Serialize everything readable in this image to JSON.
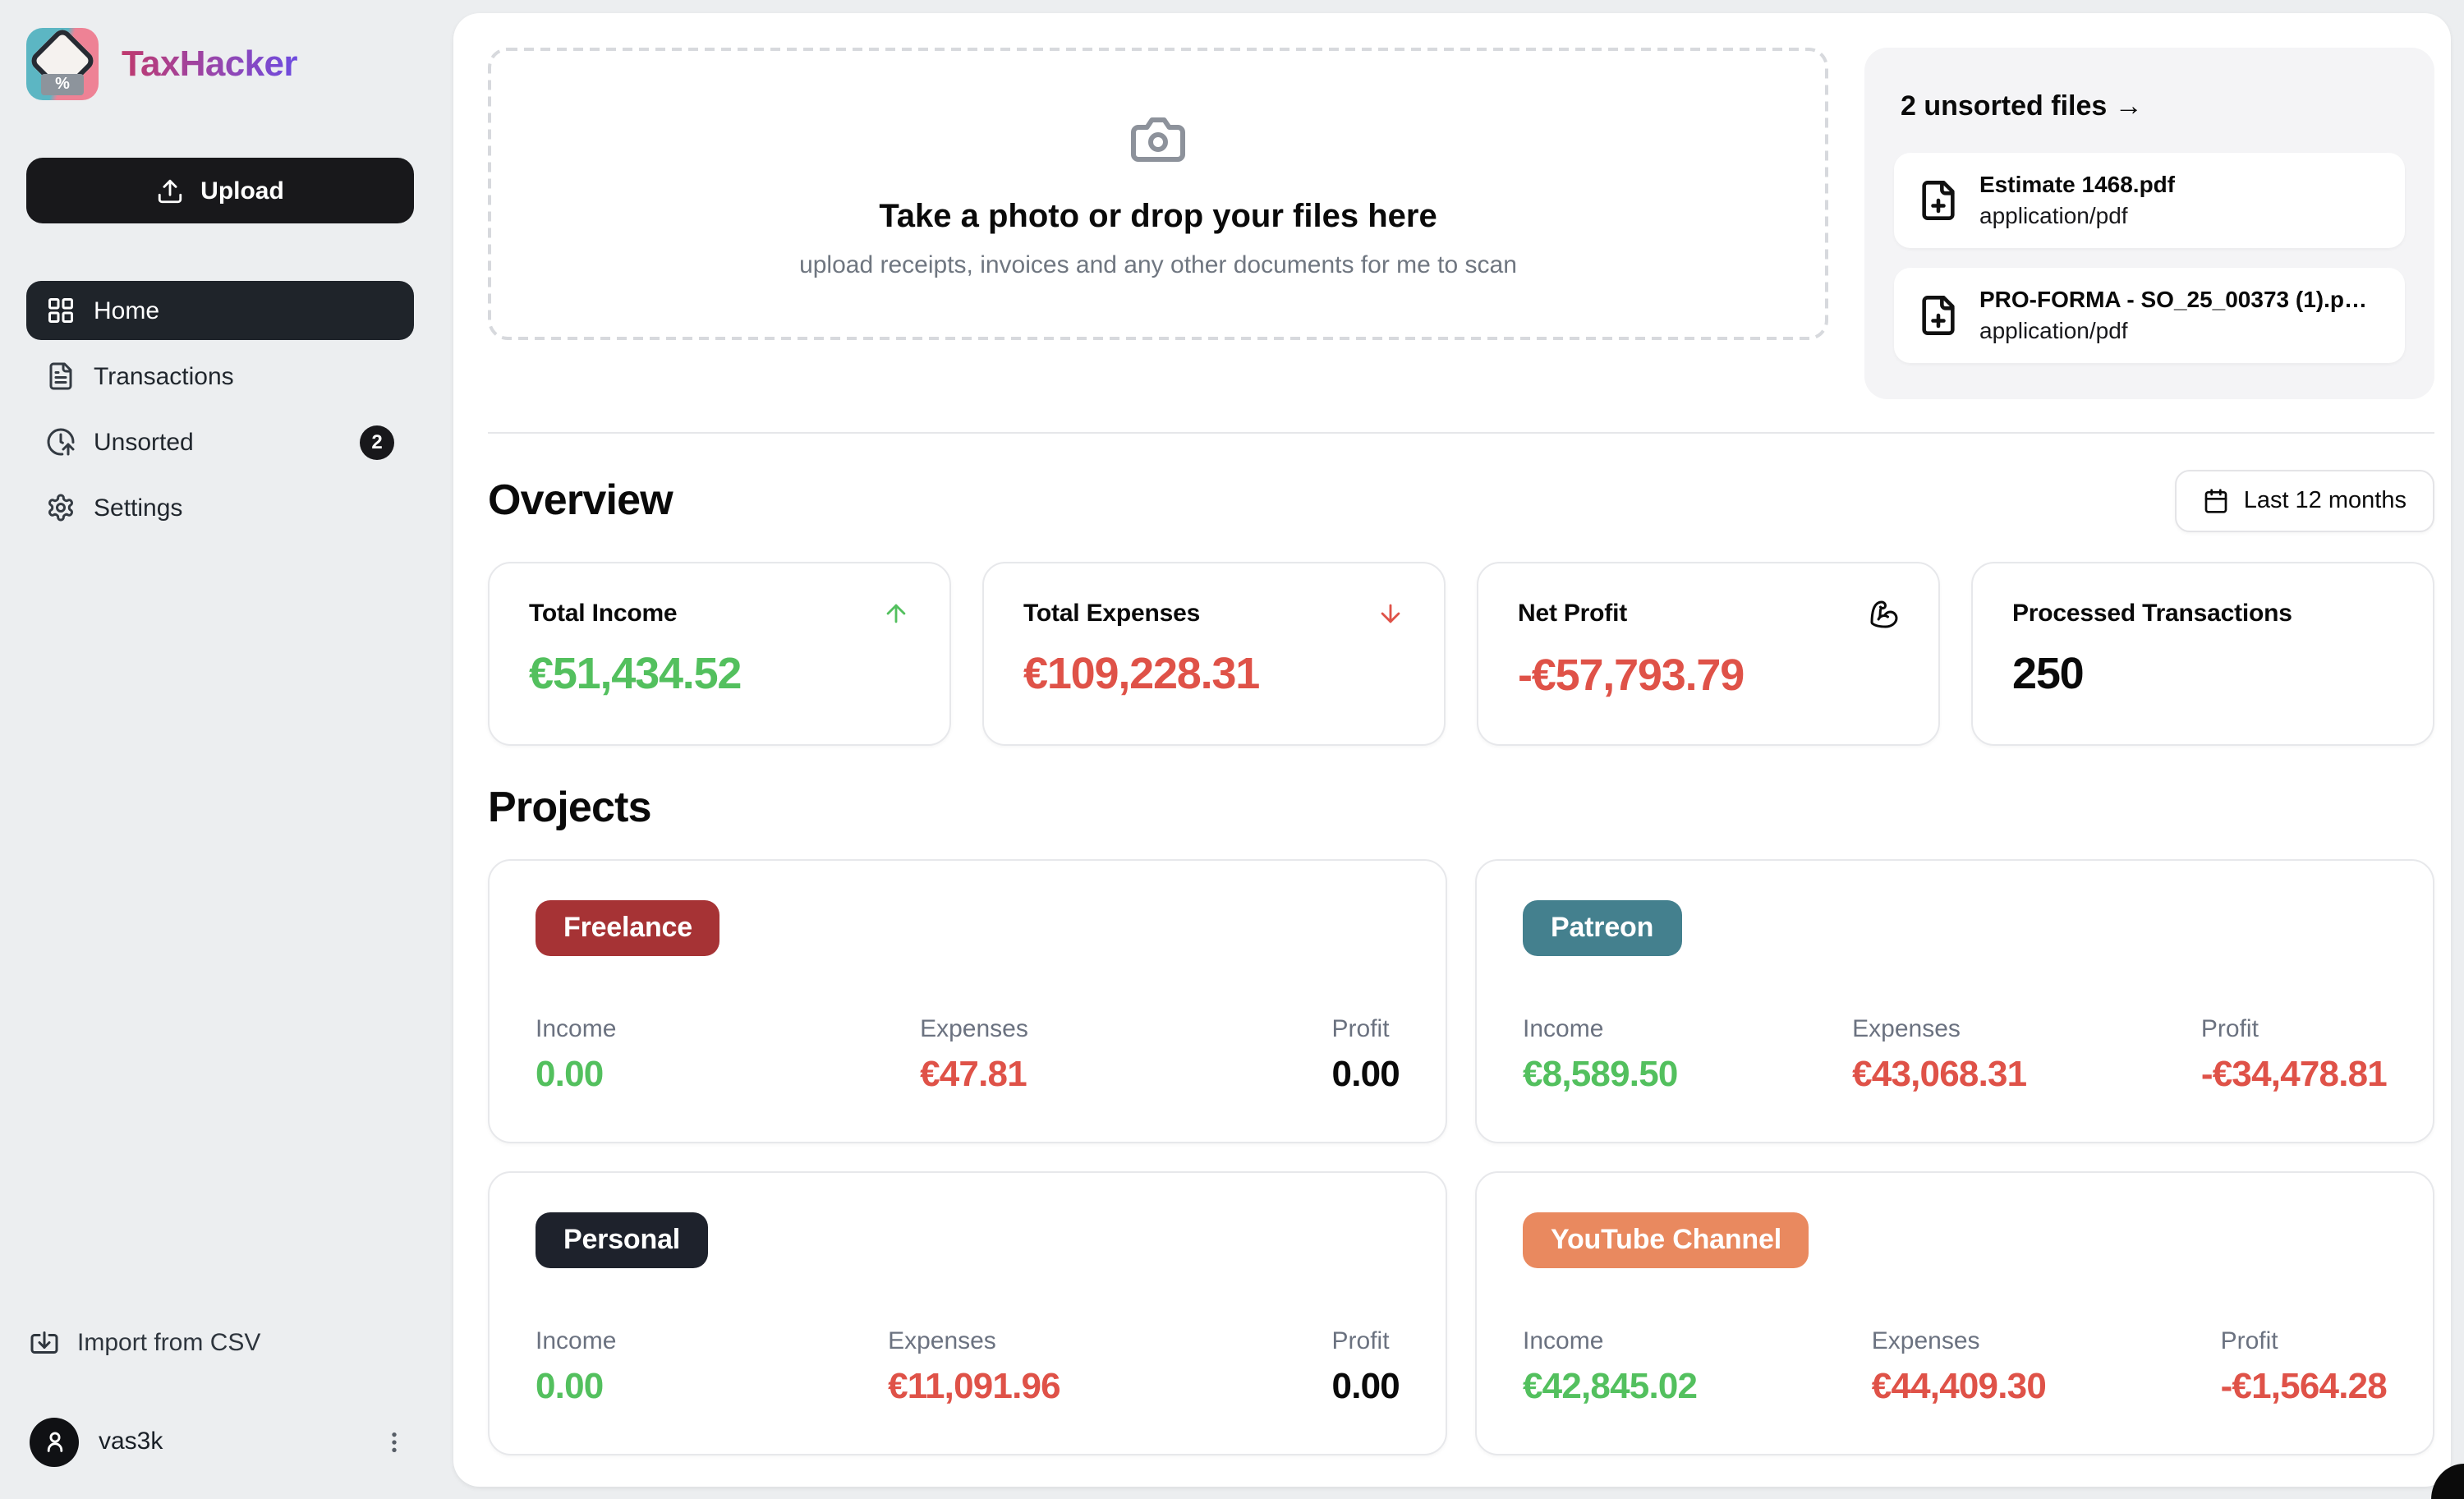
{
  "app": {
    "title": "TaxHacker"
  },
  "colors": {
    "positive_green": "#53c05e",
    "negative_red": "#df5248",
    "page_bg": "#eceef0",
    "active_nav_bg": "#1f242a",
    "upload_button_bg": "#18181b",
    "title_gradient_from": "#bf3a6e",
    "title_gradient_to": "#6d4be0",
    "badge_freelance": "#a63335",
    "badge_patreon": "#44808e",
    "badge_personal": "#1e222c",
    "badge_youtube": "#e9895f"
  },
  "sidebar": {
    "upload_label": "Upload",
    "nav": [
      {
        "label": "Home",
        "icon": "layout-grid-icon",
        "active": true
      },
      {
        "label": "Transactions",
        "icon": "file-text-icon",
        "active": false
      },
      {
        "label": "Unsorted",
        "icon": "clock-arrow-up-icon",
        "badge": "2",
        "active": false
      },
      {
        "label": "Settings",
        "icon": "gear-icon",
        "active": false
      }
    ],
    "import_label": "Import from CSV",
    "user": {
      "name": "vas3k"
    }
  },
  "main": {
    "dropzone": {
      "title": "Take a photo or drop your files here",
      "subtitle": "upload receipts, invoices and any other documents for me to scan"
    },
    "unsorted_panel": {
      "title": "2 unsorted files →",
      "files": [
        {
          "name": "Estimate 1468.pdf",
          "mime": "application/pdf"
        },
        {
          "name": "PRO-FORMA - SO_25_00373 (1).p…",
          "mime": "application/pdf"
        }
      ]
    },
    "overview": {
      "title": "Overview",
      "period_label": "Last 12 months",
      "stats": [
        {
          "label": "Total Income",
          "value": "€51,434.52",
          "class": "c-green",
          "icon": "arrow-up-icon"
        },
        {
          "label": "Total Expenses",
          "value": "€109,228.31",
          "class": "c-red",
          "icon": "arrow-down-icon"
        },
        {
          "label": "Net Profit",
          "value": "-€57,793.79",
          "class": "c-red",
          "icon": "biceps-flexed-icon"
        },
        {
          "label": "Processed Transactions",
          "value": "250",
          "class": "c-dark",
          "icon": ""
        }
      ]
    },
    "projects": {
      "title": "Projects",
      "cards": [
        {
          "name": "Freelance",
          "badge_bg": "#a63335",
          "stats": [
            {
              "label": "Income",
              "value": "0.00",
              "class": "c-green"
            },
            {
              "label": "Expenses",
              "value": "€47.81",
              "class": "c-red"
            },
            {
              "label": "Profit",
              "value": "0.00",
              "class": "c-dark"
            }
          ]
        },
        {
          "name": "Patreon",
          "badge_bg": "#44808e",
          "stats": [
            {
              "label": "Income",
              "value": "€8,589.50",
              "class": "c-green"
            },
            {
              "label": "Expenses",
              "value": "€43,068.31",
              "class": "c-red"
            },
            {
              "label": "Profit",
              "value": "-€34,478.81",
              "class": "c-red"
            }
          ]
        },
        {
          "name": "Personal",
          "badge_bg": "#1e222c",
          "stats": [
            {
              "label": "Income",
              "value": "0.00",
              "class": "c-green"
            },
            {
              "label": "Expenses",
              "value": "€11,091.96",
              "class": "c-red"
            },
            {
              "label": "Profit",
              "value": "0.00",
              "class": "c-dark"
            }
          ]
        },
        {
          "name": "YouTube Channel",
          "badge_bg": "#e9895f",
          "stats": [
            {
              "label": "Income",
              "value": "€42,845.02",
              "class": "c-green"
            },
            {
              "label": "Expenses",
              "value": "€44,409.30",
              "class": "c-red"
            },
            {
              "label": "Profit",
              "value": "-€1,564.28",
              "class": "c-red"
            }
          ]
        }
      ]
    }
  }
}
